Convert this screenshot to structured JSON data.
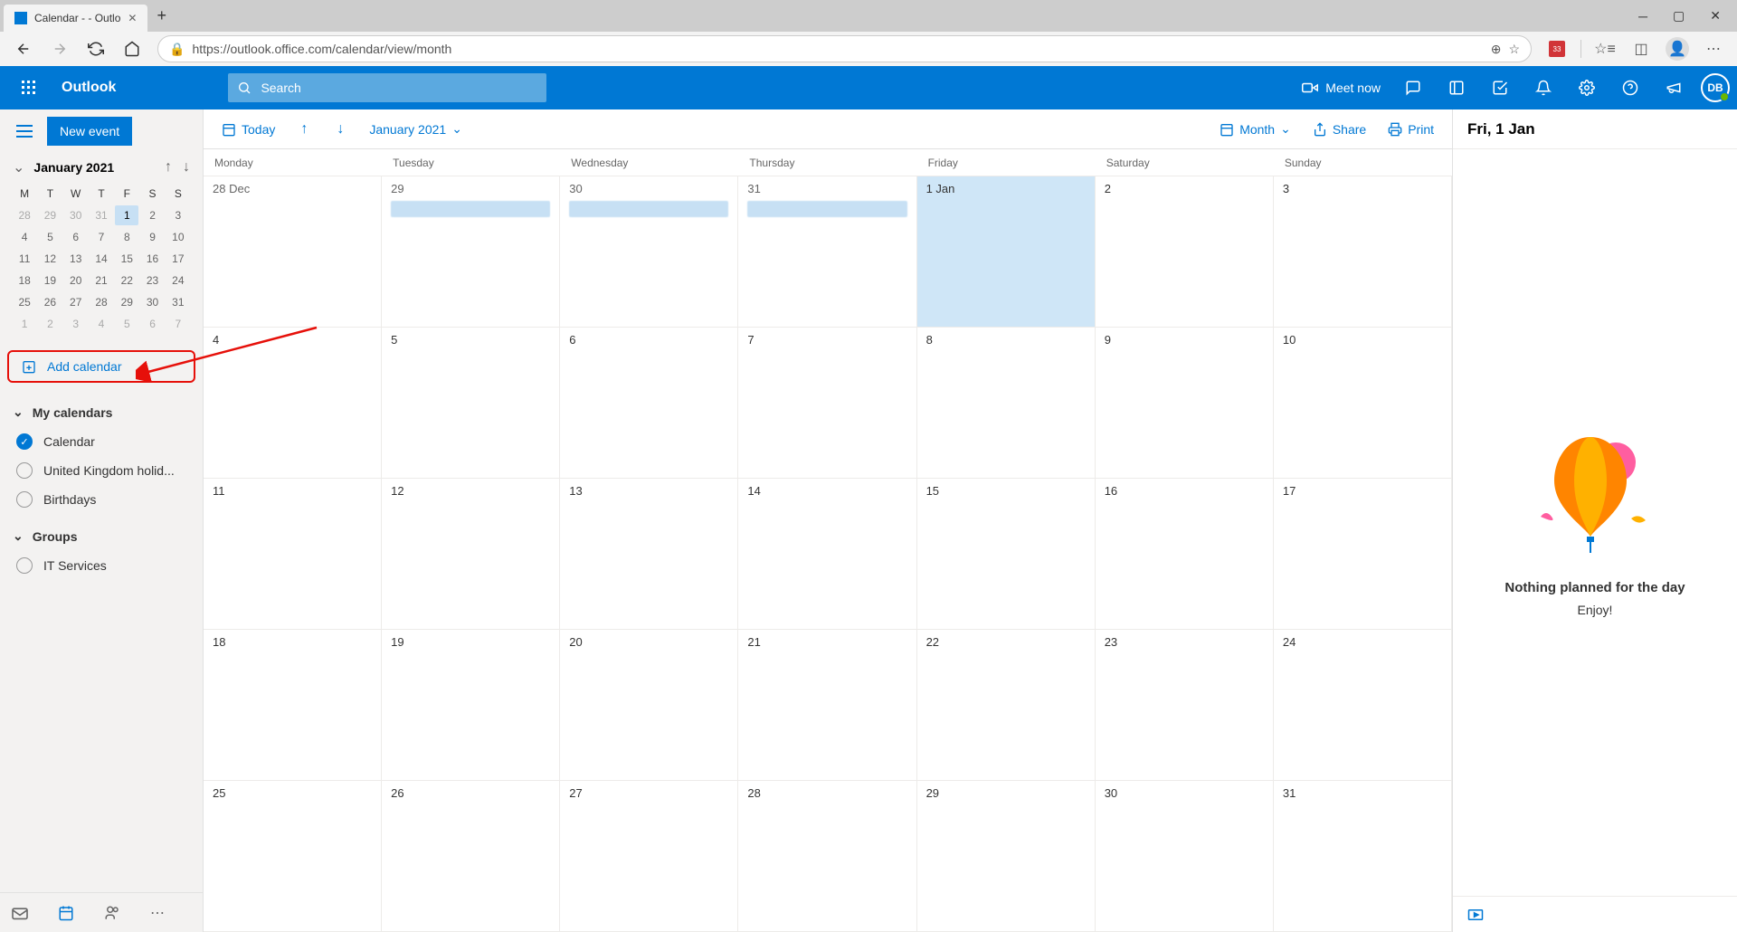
{
  "browser": {
    "tab_title": "Calendar -                    - Outlo",
    "url": "https://outlook.office.com/calendar/view/month",
    "ext_badge": "33"
  },
  "header": {
    "brand": "Outlook",
    "search_placeholder": "Search",
    "meet_now": "Meet now",
    "user_initials": "DB"
  },
  "sidebar": {
    "new_event": "New event",
    "mini_month": "January 2021",
    "dow": [
      "M",
      "T",
      "W",
      "T",
      "F",
      "S",
      "S"
    ],
    "add_calendar": "Add calendar",
    "my_calendars_label": "My calendars",
    "groups_label": "Groups",
    "calendars": [
      {
        "label": "Calendar",
        "checked": true
      },
      {
        "label": "United Kingdom holid...",
        "checked": false
      },
      {
        "label": "Birthdays",
        "checked": false
      }
    ],
    "groups": [
      {
        "label": "IT Services",
        "checked": false
      }
    ]
  },
  "mini_cal": {
    "rows": [
      [
        {
          "n": "28",
          "out": true
        },
        {
          "n": "29",
          "out": true
        },
        {
          "n": "30",
          "out": true
        },
        {
          "n": "31",
          "out": true
        },
        {
          "n": "1",
          "sel": true
        },
        {
          "n": "2"
        },
        {
          "n": "3"
        }
      ],
      [
        {
          "n": "4"
        },
        {
          "n": "5"
        },
        {
          "n": "6"
        },
        {
          "n": "7"
        },
        {
          "n": "8"
        },
        {
          "n": "9"
        },
        {
          "n": "10"
        }
      ],
      [
        {
          "n": "11"
        },
        {
          "n": "12"
        },
        {
          "n": "13"
        },
        {
          "n": "14"
        },
        {
          "n": "15"
        },
        {
          "n": "16"
        },
        {
          "n": "17"
        }
      ],
      [
        {
          "n": "18"
        },
        {
          "n": "19"
        },
        {
          "n": "20"
        },
        {
          "n": "21"
        },
        {
          "n": "22"
        },
        {
          "n": "23"
        },
        {
          "n": "24"
        }
      ],
      [
        {
          "n": "25"
        },
        {
          "n": "26"
        },
        {
          "n": "27"
        },
        {
          "n": "28"
        },
        {
          "n": "29"
        },
        {
          "n": "30"
        },
        {
          "n": "31"
        }
      ],
      [
        {
          "n": "1",
          "out": true
        },
        {
          "n": "2",
          "out": true
        },
        {
          "n": "3",
          "out": true
        },
        {
          "n": "4",
          "out": true
        },
        {
          "n": "5",
          "out": true
        },
        {
          "n": "6",
          "out": true
        },
        {
          "n": "7",
          "out": true
        }
      ]
    ]
  },
  "toolbar": {
    "today": "Today",
    "month_label": "January 2021",
    "view_label": "Month",
    "share": "Share",
    "print": "Print"
  },
  "calendar": {
    "dow": [
      "Monday",
      "Tuesday",
      "Wednesday",
      "Thursday",
      "Friday",
      "Saturday",
      "Sunday"
    ],
    "weeks": [
      [
        {
          "label": "28 Dec",
          "other": true
        },
        {
          "label": "29",
          "other": true,
          "evt": true
        },
        {
          "label": "30",
          "other": true,
          "evt": true
        },
        {
          "label": "31",
          "other": true,
          "evt": true
        },
        {
          "label": "1 Jan",
          "today": true
        },
        {
          "label": "2"
        },
        {
          "label": "3"
        }
      ],
      [
        {
          "label": "4"
        },
        {
          "label": "5"
        },
        {
          "label": "6"
        },
        {
          "label": "7"
        },
        {
          "label": "8"
        },
        {
          "label": "9"
        },
        {
          "label": "10"
        }
      ],
      [
        {
          "label": "11"
        },
        {
          "label": "12"
        },
        {
          "label": "13"
        },
        {
          "label": "14"
        },
        {
          "label": "15"
        },
        {
          "label": "16"
        },
        {
          "label": "17"
        }
      ],
      [
        {
          "label": "18"
        },
        {
          "label": "19"
        },
        {
          "label": "20"
        },
        {
          "label": "21"
        },
        {
          "label": "22"
        },
        {
          "label": "23"
        },
        {
          "label": "24"
        }
      ],
      [
        {
          "label": "25"
        },
        {
          "label": "26"
        },
        {
          "label": "27"
        },
        {
          "label": "28"
        },
        {
          "label": "29"
        },
        {
          "label": "30"
        },
        {
          "label": "31"
        }
      ]
    ]
  },
  "detail": {
    "date_label": "Fri, 1 Jan",
    "empty_title": "Nothing planned for the day",
    "empty_sub": "Enjoy!"
  }
}
